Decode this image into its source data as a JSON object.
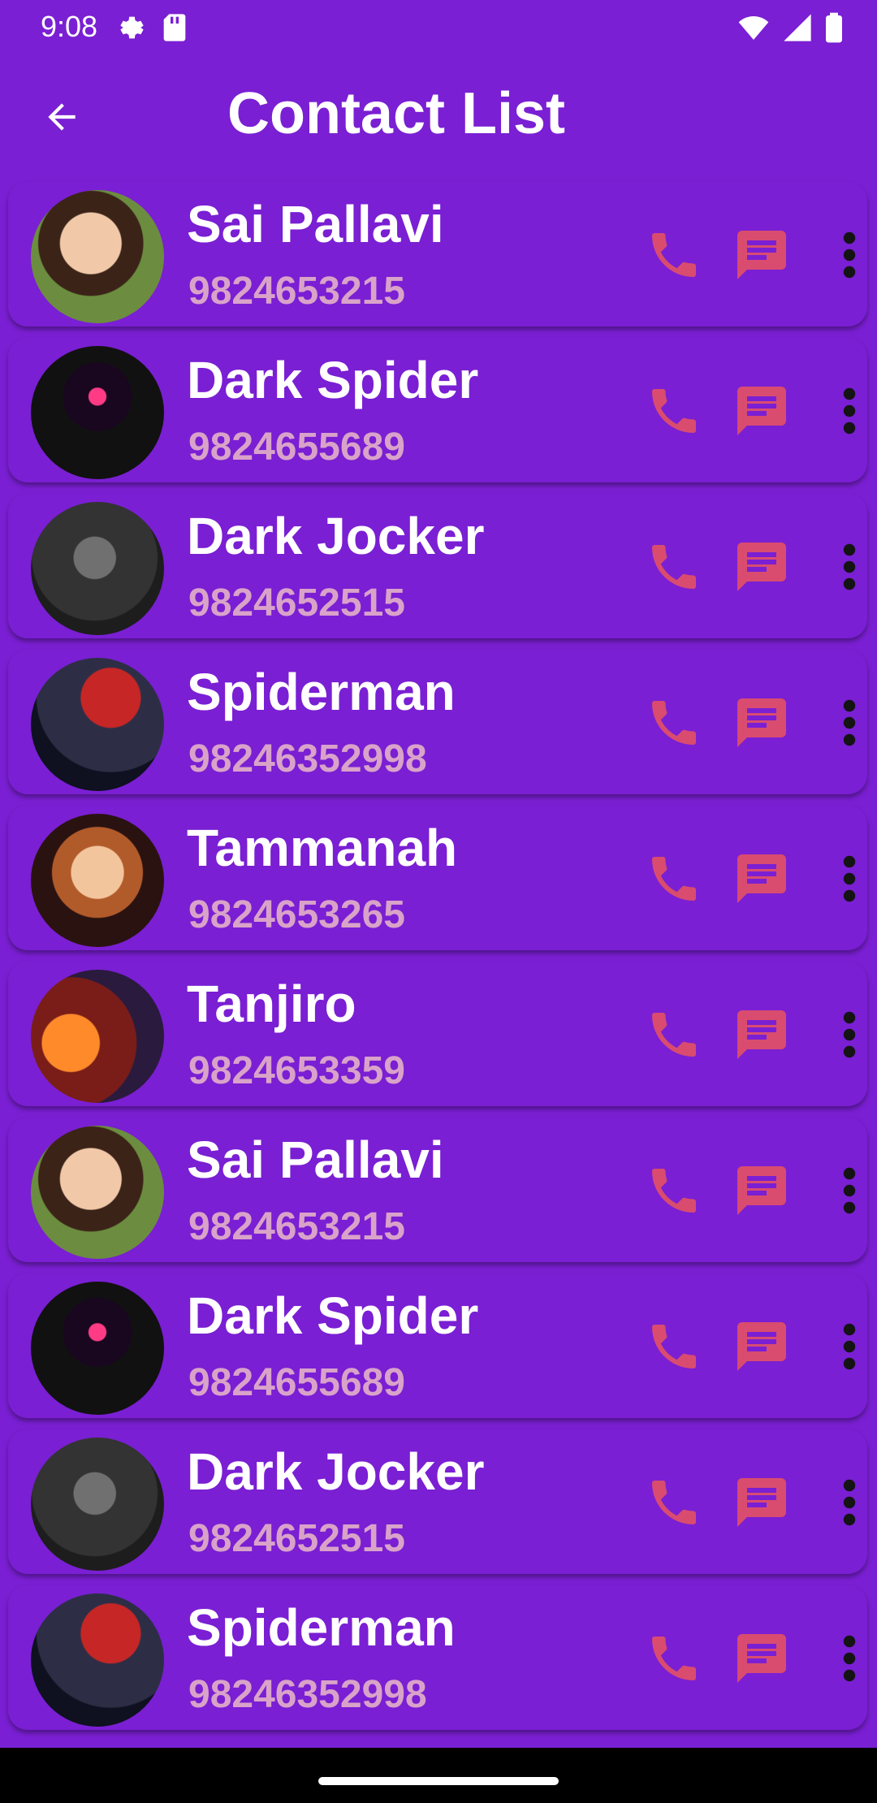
{
  "status_bar": {
    "time": "9:08",
    "left_icons": [
      "settings-icon",
      "sd-card-icon"
    ],
    "right_icons": [
      "wifi-icon",
      "signal-icon",
      "battery-icon"
    ]
  },
  "app_bar": {
    "title": "Contact List",
    "back_icon": "arrow-back-icon"
  },
  "colors": {
    "background": "#7a1fd3",
    "title": "#ffffff",
    "phone_text": "#d9a3c9",
    "action_icon": "#d94c6f"
  },
  "contacts": [
    {
      "name": "Sai Pallavi",
      "phone": "9824653215",
      "avatar": "photo"
    },
    {
      "name": "Dark Spider",
      "phone": "9824655689",
      "avatar": "photo"
    },
    {
      "name": "Dark Jocker",
      "phone": "9824652515",
      "avatar": "photo"
    },
    {
      "name": "Spiderman",
      "phone": "98246352998",
      "avatar": "photo"
    },
    {
      "name": "Tammanah",
      "phone": "9824653265",
      "avatar": "photo"
    },
    {
      "name": "Tanjiro",
      "phone": "9824653359",
      "avatar": "photo"
    },
    {
      "name": "Sai Pallavi",
      "phone": "9824653215",
      "avatar": "photo"
    },
    {
      "name": "Dark Spider",
      "phone": "9824655689",
      "avatar": "photo"
    },
    {
      "name": "Dark Jocker",
      "phone": "9824652515",
      "avatar": "photo"
    },
    {
      "name": "Spiderman",
      "phone": "98246352998",
      "avatar": "photo"
    }
  ],
  "contact_actions": [
    "phone-icon",
    "message-icon",
    "more-vert-icon"
  ]
}
